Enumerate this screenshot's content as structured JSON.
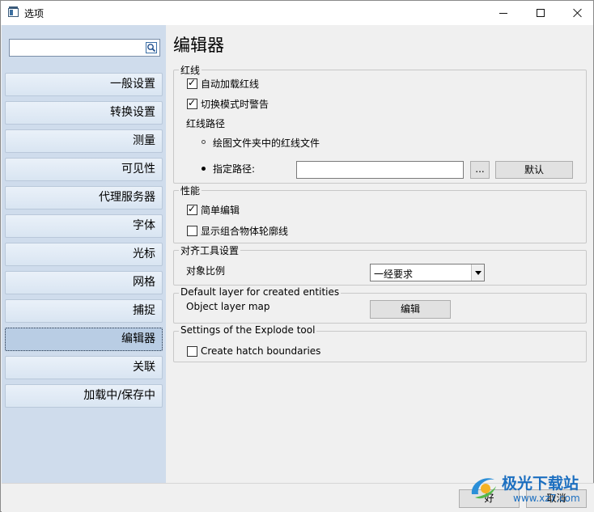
{
  "window": {
    "title": "选项"
  },
  "sidebar": {
    "search": {
      "value": "",
      "placeholder": ""
    },
    "items": [
      {
        "label": "一般设置",
        "active": false
      },
      {
        "label": "转换设置",
        "active": false
      },
      {
        "label": "测量",
        "active": false
      },
      {
        "label": "可见性",
        "active": false
      },
      {
        "label": "代理服务器",
        "active": false
      },
      {
        "label": "字体",
        "active": false
      },
      {
        "label": "光标",
        "active": false
      },
      {
        "label": "网格",
        "active": false
      },
      {
        "label": "捕捉",
        "active": false
      },
      {
        "label": "编辑器",
        "active": true
      },
      {
        "label": "关联",
        "active": false
      },
      {
        "label": "加载中/保存中",
        "active": false
      }
    ]
  },
  "main": {
    "title": "编辑器",
    "redline": {
      "group_label": "红线",
      "auto_load": {
        "label": "自动加载红线",
        "checked": true
      },
      "warn_switch": {
        "label": "切换模式时警告",
        "checked": true
      },
      "path_label": "红线路径",
      "option_folder": {
        "label": "绘图文件夹中的红线文件",
        "selected": false
      },
      "option_path": {
        "label": "指定路径:",
        "selected": true
      },
      "path_value": "",
      "browse_label": "...",
      "default_label": "默认"
    },
    "performance": {
      "group_label": "性能",
      "simple_edit": {
        "label": "简单编辑",
        "checked": true
      },
      "show_outline": {
        "label": "显示组合物体轮廓线",
        "checked": false
      }
    },
    "snap_tool": {
      "group_label": "对齐工具设置",
      "scale_label": "对象比例",
      "scale_value": "一经要求"
    },
    "default_layer": {
      "group_label": "Default layer for created entities",
      "map_label": "Object layer map",
      "edit_label": "编辑"
    },
    "explode": {
      "group_label": "Settings of the Explode tool",
      "hatch": {
        "label": "Create hatch boundaries",
        "checked": false
      }
    }
  },
  "footer": {
    "ok_label": "好",
    "cancel_label": "取消"
  },
  "watermark": {
    "text_cn": "极光下载站",
    "text_url": "www.xz7.com"
  }
}
